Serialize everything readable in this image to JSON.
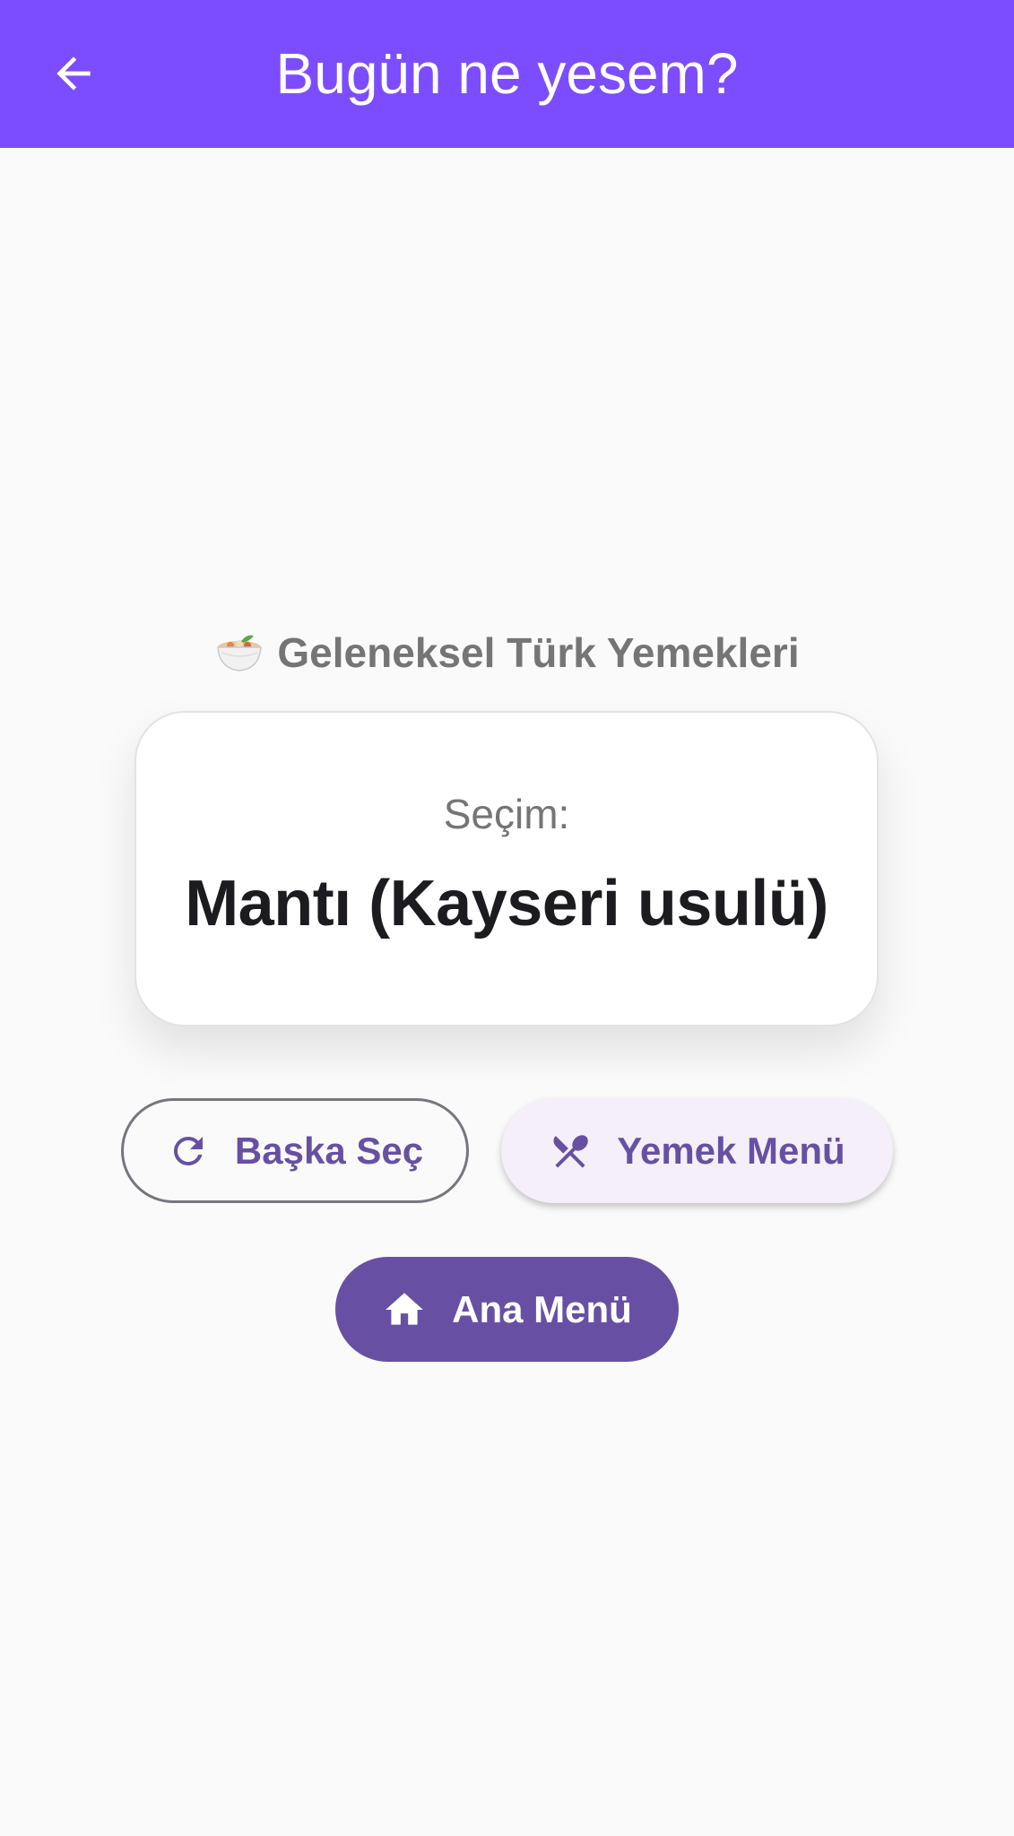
{
  "appbar": {
    "title": "Bugün ne yesem?",
    "back_icon": "arrow-back-icon",
    "color": "#7c4dff"
  },
  "category": {
    "icon": "bowl-food-icon",
    "label": "Geleneksel Türk Yemekleri"
  },
  "result_card": {
    "label": "Seçim:",
    "value": "Mantı (Kayseri usulü)"
  },
  "buttons": {
    "pick_another": {
      "label": "Başka Seç",
      "icon": "refresh-icon"
    },
    "food_menu": {
      "label": "Yemek Menü",
      "icon": "utensils-crossed-icon"
    },
    "main_menu": {
      "label": "Ana Menü",
      "icon": "home-icon"
    }
  },
  "colors": {
    "primary": "#6750a4",
    "appbar": "#7c4dff",
    "background": "#fafafa",
    "tonal_button": "#f4eff8"
  }
}
